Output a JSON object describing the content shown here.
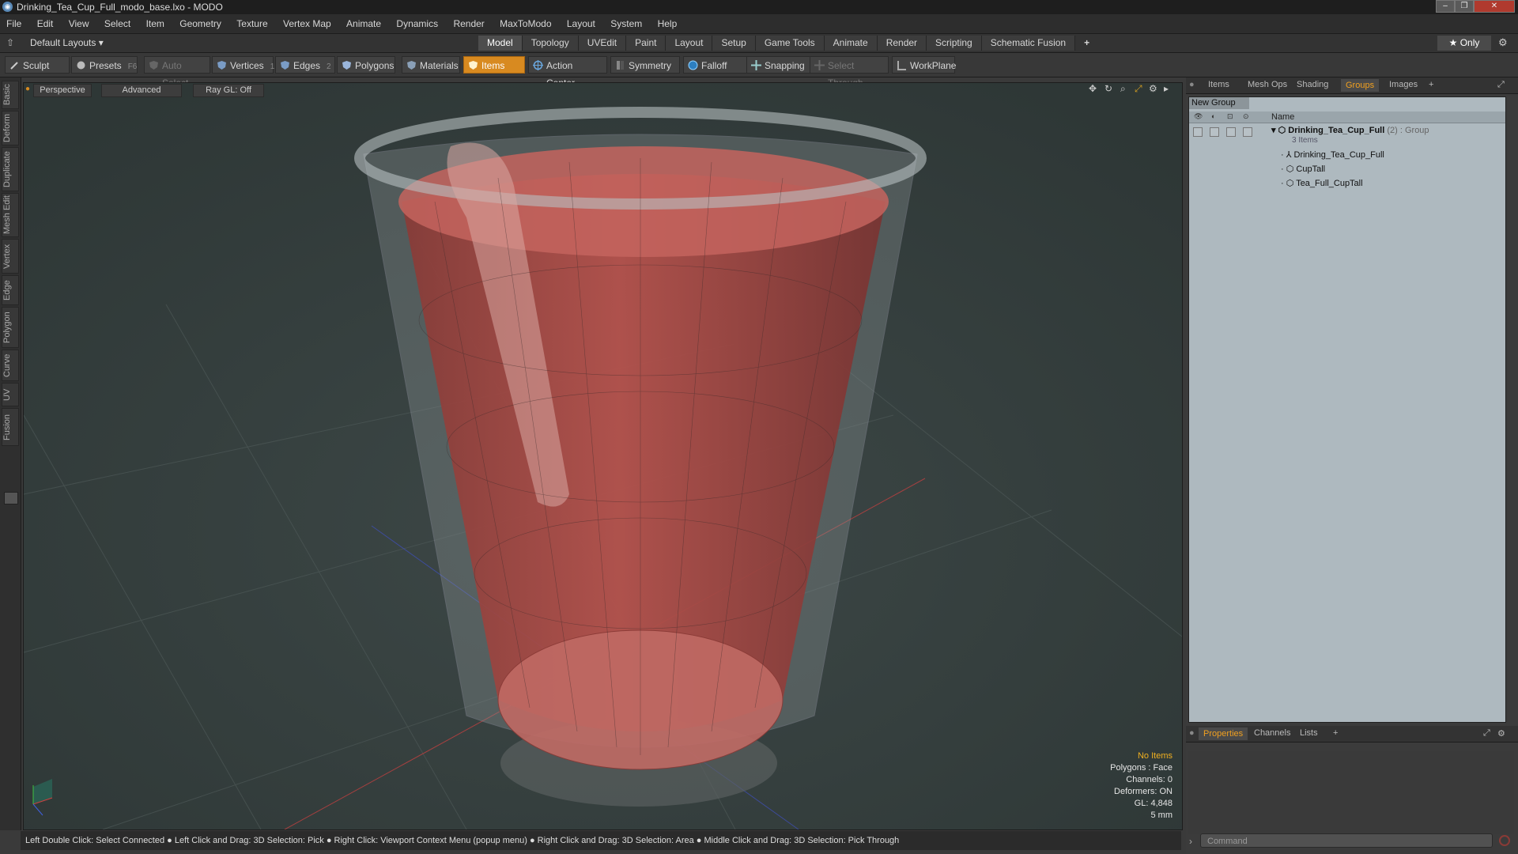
{
  "window": {
    "title": "Drinking_Tea_Cup_Full_modo_base.lxo - MODO",
    "controls": [
      "–",
      "❐",
      "✕"
    ]
  },
  "menu": [
    "File",
    "Edit",
    "View",
    "Select",
    "Item",
    "Geometry",
    "Texture",
    "Vertex Map",
    "Animate",
    "Dynamics",
    "Render",
    "MaxToModo",
    "Layout",
    "System",
    "Help"
  ],
  "layoutbar": {
    "layouts_label": "Default Layouts ▾",
    "tabs": [
      "Model",
      "Topology",
      "UVEdit",
      "Paint",
      "Layout",
      "Setup",
      "Game Tools",
      "Animate",
      "Render",
      "Scripting",
      "Schematic Fusion"
    ],
    "active_tab": "Model",
    "add_tab": "+",
    "only_label": "★ Only"
  },
  "toolbar": {
    "sculpt": "Sculpt",
    "presets": "Presets",
    "presets_key": "F6",
    "auto_select": "Auto Select",
    "vertices": "Vertices",
    "vertices_key": "1",
    "edges": "Edges",
    "edges_key": "2",
    "polygons": "Polygons",
    "materials": "Materials",
    "items": "Items",
    "action_center": "Action Center",
    "symmetry": "Symmetry",
    "falloff": "Falloff",
    "snapping": "Snapping",
    "select_through": "Select Through",
    "workplane": "WorkPlane"
  },
  "left_tabs": [
    "Basic",
    "Deform",
    "Duplicate",
    "Mesh Edit",
    "Vertex",
    "Edge",
    "Polygon",
    "Curve",
    "UV",
    "Fusion"
  ],
  "viewport": {
    "view_mode": "Perspective",
    "shading": "Advanced",
    "raygl": "Ray GL: Off",
    "hud": {
      "items": "No Items",
      "polygons": "Polygons : Face",
      "channels": "Channels: 0",
      "deformers": "Deformers: ON",
      "gl": "GL: 4,848",
      "scale": "5 mm"
    }
  },
  "statusbar": "Left Double Click: Select Connected ● Left Click and Drag: 3D Selection: Pick ● Right Click: Viewport Context Menu (popup menu) ● Right Click and Drag: 3D Selection: Area ● Middle Click and Drag: 3D Selection: Pick Through",
  "right_panel": {
    "tabs": [
      "Items",
      "Mesh Ops",
      "Shading",
      "Groups",
      "Images",
      "+"
    ],
    "active_tab": "Groups",
    "new_group": "New Group",
    "column_name": "Name",
    "group_name": "Drinking_Tea_Cup_Full",
    "group_suffix": "(2) : Group",
    "group_count": "3 Items",
    "children": [
      "Drinking_Tea_Cup_Full",
      "CupTall",
      "Tea_Full_CupTall"
    ],
    "bottom_tabs": [
      "Properties",
      "Channels",
      "Lists",
      "+"
    ],
    "bottom_active": "Properties",
    "command_placeholder": "Command"
  },
  "colors": {
    "accent": "#f0a020",
    "items_button": "#d88a20",
    "viewport_bg": "#36403f",
    "tea": "#b04a45"
  }
}
